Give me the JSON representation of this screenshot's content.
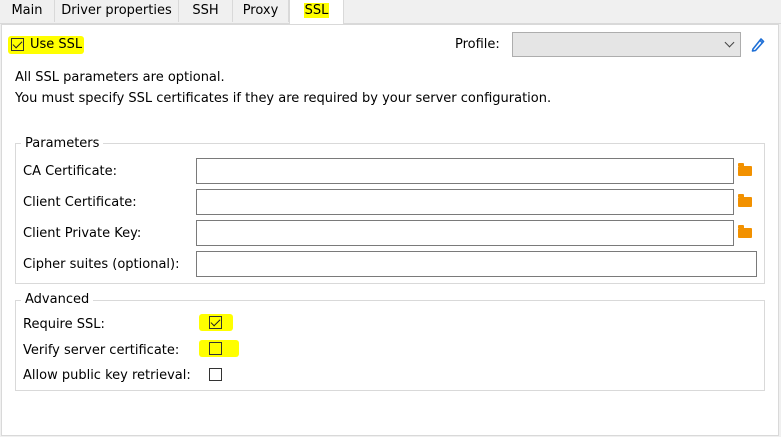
{
  "tabs": [
    {
      "label": "Main"
    },
    {
      "label": "Driver properties"
    },
    {
      "label": "SSH"
    },
    {
      "label": "Proxy"
    },
    {
      "label": "SSL"
    }
  ],
  "use_ssl": {
    "label": "Use SSL",
    "checked": true
  },
  "profile": {
    "label": "Profile:",
    "value": ""
  },
  "info": {
    "line1": "All SSL parameters are optional.",
    "line2": "You must specify SSL certificates if they are required by your server configuration."
  },
  "parameters": {
    "title": "Parameters",
    "ca_certificate": {
      "label": "CA Certificate:",
      "value": ""
    },
    "client_certificate": {
      "label": "Client Certificate:",
      "value": ""
    },
    "client_private_key": {
      "label": "Client Private Key:",
      "value": ""
    },
    "cipher_suites": {
      "label": "Cipher suites (optional):",
      "value": ""
    }
  },
  "advanced": {
    "title": "Advanced",
    "require_ssl": {
      "label": "Require SSL:",
      "checked": true
    },
    "verify_server_certificate": {
      "label": "Verify server certificate:",
      "checked": false
    },
    "allow_public_key_retrieval": {
      "label": "Allow public key retrieval:",
      "checked": false
    }
  },
  "icons": {
    "folder": "folder-icon",
    "edit": "pencil-icon",
    "dropdown": "chevron-down-icon"
  },
  "colors": {
    "highlight": "#ffff00",
    "folder": "#f29100",
    "edit": "#1e6fd6"
  }
}
